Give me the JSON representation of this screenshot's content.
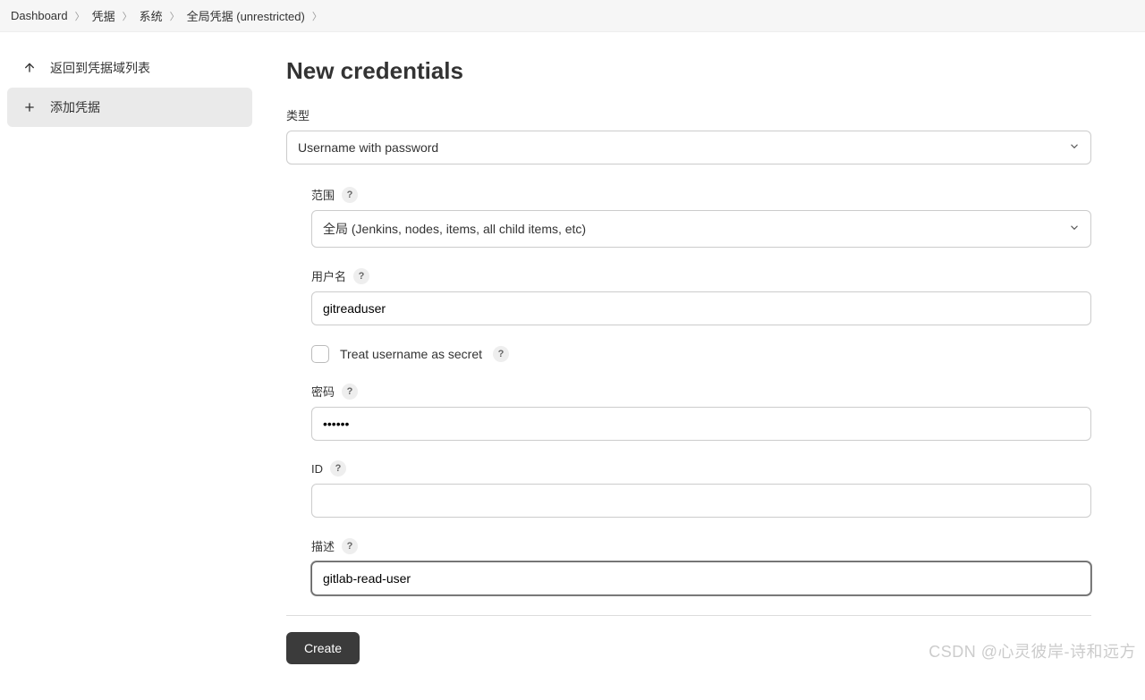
{
  "breadcrumbs": [
    "Dashboard",
    "凭据",
    "系统",
    "全局凭据 (unrestricted)"
  ],
  "sidebar": {
    "back_label": "返回到凭据域列表",
    "add_label": "添加凭据"
  },
  "page": {
    "title": "New credentials",
    "type_label": "类型",
    "type_value": "Username with password",
    "scope_label": "范围",
    "scope_value": "全局 (Jenkins, nodes, items, all child items, etc)",
    "username_label": "用户名",
    "username_value": "gitreaduser",
    "treat_secret_label": "Treat username as secret",
    "password_label": "密码",
    "password_value": "••••••",
    "id_label": "ID",
    "id_value": "",
    "desc_label": "描述",
    "desc_value": "gitlab-read-user",
    "create_label": "Create"
  },
  "watermark": "CSDN @心灵彼岸-诗和远方"
}
